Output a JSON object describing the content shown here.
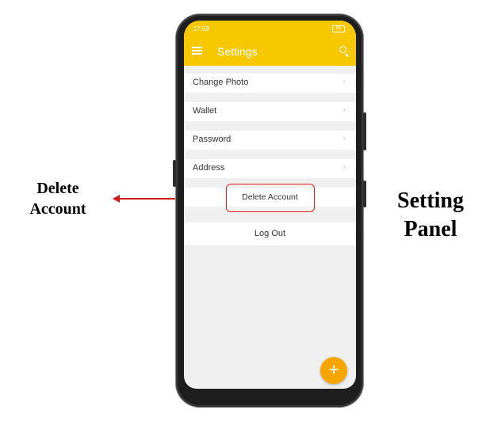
{
  "annotation_left": {
    "line1": "Delete",
    "line2": "Account"
  },
  "annotation_right": {
    "line1": "Setting",
    "line2": "Panel"
  },
  "status_bar": {
    "time": "17:59",
    "battery": "89"
  },
  "app_bar": {
    "title": "Settings",
    "menu_icon": "hamburger-menu-icon",
    "search_icon": "search-icon"
  },
  "settings_items": [
    {
      "label": "Change Photo",
      "chevron": "›"
    },
    {
      "label": "Wallet",
      "chevron": "›"
    },
    {
      "label": "Password",
      "chevron": "›"
    },
    {
      "label": "Address",
      "chevron": "›"
    }
  ],
  "delete_account": {
    "label": "Delete Account"
  },
  "logout": {
    "label": "Log Out"
  },
  "fab": {
    "symbol": "+"
  },
  "colors": {
    "accent": "#f7c800",
    "fab": "#f7a600",
    "highlight": "#e02020"
  }
}
